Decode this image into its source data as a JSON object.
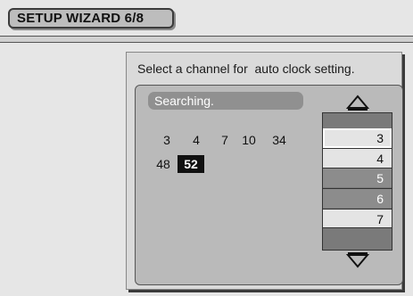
{
  "header": {
    "title": "SETUP WIZARD 6/8"
  },
  "instruction": "Select a channel for  auto clock setting.",
  "status": "Searching.",
  "found_channels": [
    "3",
    "4",
    "7",
    "10",
    "34",
    "48",
    "52"
  ],
  "selected_found": "52",
  "channel_list": [
    "3",
    "4",
    "5",
    "6",
    "7"
  ],
  "channel_list_current": "3",
  "icons": {
    "up": "triangle-up-icon",
    "down": "triangle-down-icon"
  },
  "colors": {
    "background": "#e6e6e6",
    "panel": "#dadada",
    "inner": "#bababa",
    "highlight": "#111111"
  }
}
